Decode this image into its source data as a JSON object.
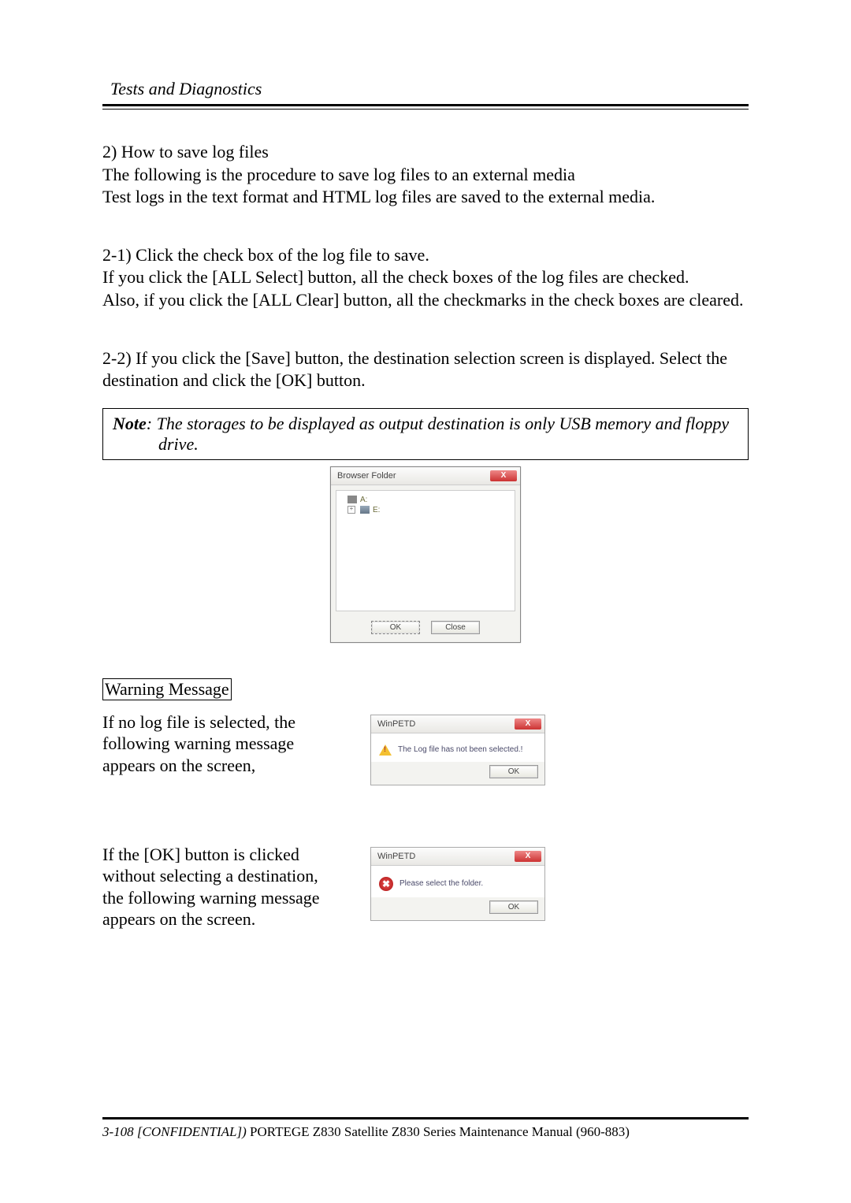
{
  "header": {
    "title": "Tests and Diagnostics"
  },
  "section2": {
    "heading": "2) How to save log files",
    "p1": "The following is the procedure to save log files to an external media",
    "p2": "Test logs in the text format and HTML log files are saved to the external media."
  },
  "section21": {
    "p1": "2-1) Click the check box of the log file to save.",
    "p2": "If you click the [ALL Select] button, all the check boxes of the log files are checked.",
    "p3": "Also, if you click the [ALL Clear] button, all the checkmarks in the check boxes are cleared."
  },
  "section22": {
    "p1": "2-2) If you click the [Save] button, the destination selection screen is displayed. Select the destination and click the [OK] button."
  },
  "note": {
    "label": "Note",
    "text": ": The storages to be displayed as output destination is only USB memory and floppy",
    "text2": "drive."
  },
  "browser_dialog": {
    "title": "Browser Folder",
    "drive_a": "A:",
    "drive_e": "E:",
    "ok": "OK",
    "close": "Close"
  },
  "warning": {
    "heading": "Warning Message",
    "p1": "If no log file is selected, the following warning message appears on the screen,",
    "p2": "If the [OK] button is clicked without selecting a destination, the following warning message appears on the screen."
  },
  "msgbox1": {
    "title": "WinPETD",
    "text": "The Log file has not been selected.!",
    "ok": "OK"
  },
  "msgbox2": {
    "title": "WinPETD",
    "text": "Please select the folder.",
    "ok": "OK"
  },
  "footer": {
    "prefix": "3-108 [CONFIDENTIAL])",
    "rest": " PORTEGE Z830 Satellite Z830 Series Maintenance Manual (960-883)"
  }
}
